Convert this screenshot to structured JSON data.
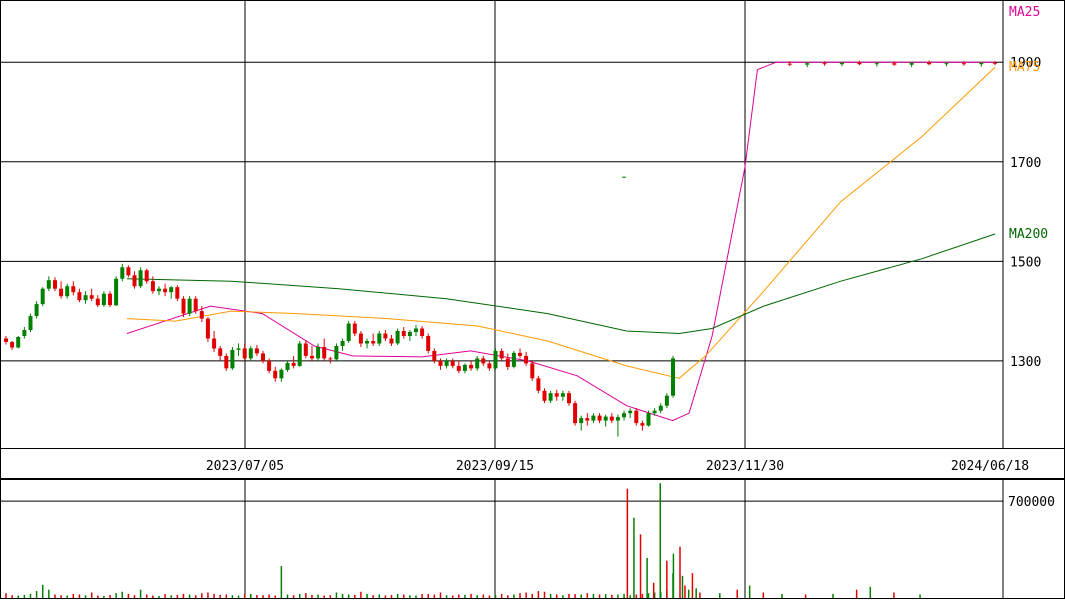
{
  "chart_data": [
    {
      "type": "line",
      "chart_kind": "candlestick",
      "grid": true,
      "y_axis_side": "right",
      "ylim": [
        1125,
        2025
      ],
      "y_ticks": [
        1300,
        1500,
        1700,
        1900
      ],
      "y_tick_labels": [
        "1300",
        "1500",
        "1700",
        "1900"
      ],
      "x_tick_labels": [
        "2023/07/05",
        "2023/09/15",
        "2023/11/30",
        "2024/06/18"
      ],
      "up_color": "#008000",
      "down_color": "#e00000",
      "ohlc_daily": [
        [
          1345,
          1350,
          1333,
          1338
        ],
        [
          1338,
          1340,
          1322,
          1327
        ],
        [
          1327,
          1350,
          1325,
          1348
        ],
        [
          1350,
          1368,
          1345,
          1362
        ],
        [
          1362,
          1395,
          1358,
          1390
        ],
        [
          1390,
          1420,
          1385,
          1414
        ],
        [
          1414,
          1448,
          1410,
          1445
        ],
        [
          1445,
          1470,
          1440,
          1462
        ],
        [
          1462,
          1468,
          1440,
          1445
        ],
        [
          1445,
          1460,
          1425,
          1430
        ],
        [
          1430,
          1455,
          1425,
          1450
        ],
        [
          1450,
          1460,
          1432,
          1438
        ],
        [
          1438,
          1445,
          1418,
          1422
        ],
        [
          1422,
          1440,
          1415,
          1432
        ],
        [
          1432,
          1445,
          1420,
          1425
        ],
        [
          1425,
          1432,
          1408,
          1412
        ],
        [
          1412,
          1440,
          1408,
          1435
        ],
        [
          1435,
          1440,
          1408,
          1412
        ],
        [
          1412,
          1470,
          1410,
          1465
        ],
        [
          1465,
          1495,
          1460,
          1488
        ],
        [
          1488,
          1492,
          1468,
          1472
        ],
        [
          1472,
          1480,
          1445,
          1450
        ],
        [
          1450,
          1488,
          1446,
          1482
        ],
        [
          1482,
          1485,
          1455,
          1460
        ],
        [
          1460,
          1470,
          1435,
          1440
        ],
        [
          1440,
          1450,
          1432,
          1445
        ],
        [
          1445,
          1455,
          1430,
          1438
        ],
        [
          1438,
          1450,
          1425,
          1448
        ],
        [
          1448,
          1452,
          1420,
          1425
        ],
        [
          1425,
          1430,
          1388,
          1395
        ],
        [
          1395,
          1430,
          1390,
          1425
        ],
        [
          1425,
          1430,
          1395,
          1400
        ],
        [
          1400,
          1410,
          1378,
          1385
        ],
        [
          1385,
          1388,
          1338,
          1345
        ],
        [
          1345,
          1360,
          1318,
          1325
        ],
        [
          1325,
          1330,
          1300,
          1310
        ],
        [
          1310,
          1315,
          1280,
          1285
        ],
        [
          1285,
          1328,
          1282,
          1322
        ],
        [
          1322,
          1335,
          1310,
          1325
        ],
        [
          1325,
          1335,
          1300,
          1305
        ],
        [
          1305,
          1330,
          1300,
          1325
        ],
        [
          1325,
          1332,
          1310,
          1315
        ],
        [
          1315,
          1320,
          1295,
          1300
        ],
        [
          1300,
          1305,
          1275,
          1280
        ],
        [
          1280,
          1288,
          1258,
          1265
        ],
        [
          1265,
          1285,
          1258,
          1282
        ],
        [
          1282,
          1300,
          1278,
          1296
        ],
        [
          1296,
          1310,
          1285,
          1290
        ],
        [
          1290,
          1340,
          1288,
          1335
        ],
        [
          1335,
          1342,
          1305,
          1310
        ],
        [
          1310,
          1330,
          1300,
          1305
        ],
        [
          1305,
          1335,
          1300,
          1328
        ],
        [
          1328,
          1345,
          1300,
          1305
        ],
        [
          1305,
          1308,
          1295,
          1303
        ],
        [
          1303,
          1335,
          1300,
          1330
        ],
        [
          1330,
          1345,
          1320,
          1340
        ],
        [
          1340,
          1380,
          1336,
          1375
        ],
        [
          1375,
          1380,
          1350,
          1355
        ],
        [
          1355,
          1360,
          1328,
          1335
        ],
        [
          1335,
          1345,
          1325,
          1340
        ],
        [
          1340,
          1355,
          1330,
          1335
        ],
        [
          1335,
          1360,
          1330,
          1355
        ],
        [
          1355,
          1362,
          1340,
          1345
        ],
        [
          1345,
          1352,
          1330,
          1335
        ],
        [
          1335,
          1365,
          1332,
          1360
        ],
        [
          1360,
          1368,
          1345,
          1350
        ],
        [
          1350,
          1362,
          1340,
          1358
        ],
        [
          1358,
          1372,
          1350,
          1365
        ],
        [
          1365,
          1370,
          1345,
          1350
        ],
        [
          1350,
          1355,
          1315,
          1320
        ],
        [
          1320,
          1325,
          1295,
          1300
        ],
        [
          1300,
          1305,
          1282,
          1290
        ],
        [
          1290,
          1305,
          1285,
          1300
        ],
        [
          1300,
          1305,
          1285,
          1290
        ],
        [
          1290,
          1300,
          1275,
          1280
        ],
        [
          1280,
          1295,
          1275,
          1292
        ],
        [
          1292,
          1300,
          1280,
          1285
        ],
        [
          1285,
          1310,
          1280,
          1305
        ],
        [
          1305,
          1310,
          1290,
          1295
        ],
        [
          1295,
          1300,
          1280,
          1285
        ],
        [
          1285,
          1325,
          1282,
          1320
        ],
        [
          1320,
          1325,
          1300,
          1305
        ],
        [
          1305,
          1315,
          1282,
          1288
        ],
        [
          1288,
          1320,
          1285,
          1316
        ],
        [
          1316,
          1325,
          1305,
          1310
        ],
        [
          1310,
          1318,
          1290,
          1295
        ],
        [
          1295,
          1300,
          1260,
          1265
        ],
        [
          1265,
          1270,
          1235,
          1240
        ],
        [
          1240,
          1245,
          1215,
          1220
        ],
        [
          1220,
          1240,
          1215,
          1235
        ],
        [
          1235,
          1242,
          1220,
          1228
        ],
        [
          1228,
          1240,
          1220,
          1235
        ],
        [
          1235,
          1240,
          1210,
          1215
        ],
        [
          1215,
          1220,
          1170,
          1175
        ],
        [
          1175,
          1190,
          1160,
          1185
        ],
        [
          1185,
          1195,
          1170,
          1180
        ],
        [
          1180,
          1195,
          1175,
          1190
        ],
        [
          1190,
          1195,
          1175,
          1180
        ],
        [
          1180,
          1192,
          1168,
          1188
        ],
        [
          1188,
          1195,
          1175,
          1180
        ],
        [
          1180,
          1192,
          1148,
          1187
        ],
        [
          1187,
          1200,
          1180,
          1195
        ],
        [
          1195,
          1205,
          1185,
          1200
        ],
        [
          1200,
          1205,
          1170,
          1175
        ],
        [
          1175,
          1180,
          1160,
          1170
        ],
        [
          1170,
          1200,
          1168,
          1195
        ],
        [
          1195,
          1205,
          1190,
          1200
        ],
        [
          1200,
          1215,
          1195,
          1210
        ],
        [
          1210,
          1235,
          1205,
          1230
        ],
        [
          1230,
          1310,
          1226,
          1305
        ]
      ],
      "ohlc_later": [
        {
          "x": "2024-01-05",
          "o": 1897,
          "h": 1902,
          "l": 1892,
          "c": 1895
        },
        {
          "x": "2024-01-19",
          "o": 1895,
          "h": 1900,
          "l": 1890,
          "c": 1898
        },
        {
          "x": "2024-02-02",
          "o": 1898,
          "h": 1902,
          "l": 1893,
          "c": 1896
        },
        {
          "x": "2024-02-16",
          "o": 1896,
          "h": 1900,
          "l": 1892,
          "c": 1899
        },
        {
          "x": "2024-03-01",
          "o": 1899,
          "h": 1903,
          "l": 1894,
          "c": 1896
        },
        {
          "x": "2024-03-15",
          "o": 1896,
          "h": 1901,
          "l": 1891,
          "c": 1898
        },
        {
          "x": "2024-03-29",
          "o": 1898,
          "h": 1902,
          "l": 1893,
          "c": 1895
        },
        {
          "x": "2024-04-12",
          "o": 1895,
          "h": 1900,
          "l": 1890,
          "c": 1899
        },
        {
          "x": "2024-04-26",
          "o": 1899,
          "h": 1903,
          "l": 1894,
          "c": 1896
        },
        {
          "x": "2024-05-10",
          "o": 1896,
          "h": 1900,
          "l": 1892,
          "c": 1898
        },
        {
          "x": "2024-05-24",
          "o": 1898,
          "h": 1902,
          "l": 1893,
          "c": 1896
        },
        {
          "x": "2024-06-07",
          "o": 1896,
          "h": 1900,
          "l": 1891,
          "c": 1899
        },
        {
          "x": "2024-06-18",
          "o": 1899,
          "h": 1902,
          "l": 1894,
          "c": 1897
        }
      ],
      "series": [
        {
          "name": "MA25",
          "color": "#dd0099",
          "points": [
            [
              "2023-06-01",
              1355
            ],
            [
              "2023-06-25",
              1410
            ],
            [
              "2023-07-10",
              1395
            ],
            [
              "2023-07-25",
              1330
            ],
            [
              "2023-08-05",
              1310
            ],
            [
              "2023-08-25",
              1308
            ],
            [
              "2023-09-08",
              1320
            ],
            [
              "2023-09-25",
              1300
            ],
            [
              "2023-10-10",
              1270
            ],
            [
              "2023-10-25",
              1210
            ],
            [
              "2023-11-08",
              1180
            ],
            [
              "2023-11-13",
              1195
            ],
            [
              "2023-11-20",
              1350
            ],
            [
              "2023-11-30",
              1690
            ],
            [
              "2023-12-10",
              1885
            ],
            [
              "2023-12-25",
              1900
            ],
            [
              "2024-06-18",
              1900
            ]
          ]
        },
        {
          "name": "MA75",
          "color": "#ff9900",
          "points": [
            [
              "2023-06-01",
              1385
            ],
            [
              "2023-06-15",
              1380
            ],
            [
              "2023-07-01",
              1400
            ],
            [
              "2023-07-20",
              1395
            ],
            [
              "2023-08-15",
              1385
            ],
            [
              "2023-09-10",
              1370
            ],
            [
              "2023-10-01",
              1340
            ],
            [
              "2023-10-25",
              1290
            ],
            [
              "2023-11-10",
              1265
            ],
            [
              "2023-11-18",
              1310
            ],
            [
              "2023-12-15",
              1440
            ],
            [
              "2024-02-15",
              1620
            ],
            [
              "2024-04-20",
              1750
            ],
            [
              "2024-06-18",
              1890
            ]
          ]
        },
        {
          "name": "MA200",
          "color": "#006600",
          "points": [
            [
              "2023-06-01",
              1465
            ],
            [
              "2023-07-01",
              1460
            ],
            [
              "2023-08-01",
              1445
            ],
            [
              "2023-09-01",
              1425
            ],
            [
              "2023-10-01",
              1395
            ],
            [
              "2023-10-25",
              1360
            ],
            [
              "2023-11-10",
              1355
            ],
            [
              "2023-11-20",
              1365
            ],
            [
              "2023-12-15",
              1410
            ],
            [
              "2024-02-15",
              1460
            ],
            [
              "2024-04-20",
              1505
            ],
            [
              "2024-06-18",
              1555
            ]
          ]
        }
      ],
      "extra_marks": [
        {
          "x": "2023-11-13",
          "o": 1669,
          "h": 1670,
          "l": 1668,
          "c": 1670
        }
      ]
    },
    {
      "type": "bar",
      "name": "volume",
      "grid": true,
      "y_axis_side": "right",
      "ylim": [
        0,
        860000
      ],
      "y_ticks": [
        700000
      ],
      "y_tick_labels": [
        "700000"
      ],
      "volume_daily": [
        35000,
        20000,
        18000,
        22000,
        30000,
        50000,
        95000,
        60000,
        25000,
        20000,
        18000,
        30000,
        25000,
        20000,
        40000,
        18000,
        15000,
        22000,
        35000,
        45000,
        30000,
        20000,
        60000,
        25000,
        18000,
        15000,
        28000,
        20000,
        22000,
        30000,
        25000,
        20000,
        35000,
        40000,
        30000,
        22000,
        25000,
        20000,
        18000,
        28000,
        30000,
        22000,
        20000,
        25000,
        18000,
        230000,
        25000,
        20000,
        30000,
        35000,
        22000,
        25000,
        18000,
        20000,
        40000,
        30000,
        25000,
        22000,
        45000,
        30000,
        20000,
        25000,
        18000,
        22000,
        30000,
        25000,
        20000,
        18000,
        28000,
        30000,
        25000,
        40000,
        20000,
        18000,
        25000,
        22000,
        30000,
        20000,
        25000,
        18000,
        22000,
        30000,
        20000,
        25000,
        35000,
        40000,
        30000,
        50000,
        45000,
        30000,
        25000,
        20000,
        30000,
        28000,
        25000,
        35000,
        30000,
        25000,
        28000,
        22000,
        25000,
        30000,
        20000,
        25000,
        30000,
        35000,
        40000,
        45000,
        60000,
        180000
      ],
      "volume_later": [
        {
          "x": "2023-11-14",
          "v": 790000
        },
        {
          "x": "2023-11-16",
          "v": 580000
        },
        {
          "x": "2023-11-18",
          "v": 460000
        },
        {
          "x": "2023-11-20",
          "v": 290000
        },
        {
          "x": "2023-11-22",
          "v": 110000
        },
        {
          "x": "2023-11-24",
          "v": 830000
        },
        {
          "x": "2023-11-26",
          "v": 270000
        },
        {
          "x": "2023-11-28",
          "v": 320000
        },
        {
          "x": "2023-11-30",
          "v": 370000
        },
        {
          "x": "2023-12-02",
          "v": 160000
        },
        {
          "x": "2023-12-04",
          "v": 90000
        },
        {
          "x": "2023-12-07",
          "v": 60000
        },
        {
          "x": "2023-12-10",
          "v": 180000
        },
        {
          "x": "2023-12-13",
          "v": 70000
        },
        {
          "x": "2023-12-16",
          "v": 40000
        },
        {
          "x": "2024-01-01",
          "v": 35000
        },
        {
          "x": "2024-01-15",
          "v": 60000
        },
        {
          "x": "2024-01-25",
          "v": 90000
        },
        {
          "x": "2024-02-05",
          "v": 40000
        },
        {
          "x": "2024-02-20",
          "v": 30000
        },
        {
          "x": "2024-03-10",
          "v": 25000
        },
        {
          "x": "2024-04-01",
          "v": 30000
        },
        {
          "x": "2024-04-20",
          "v": 60000
        },
        {
          "x": "2024-05-01",
          "v": 80000
        },
        {
          "x": "2024-05-20",
          "v": 40000
        },
        {
          "x": "2024-06-10",
          "v": 25000
        }
      ]
    }
  ]
}
